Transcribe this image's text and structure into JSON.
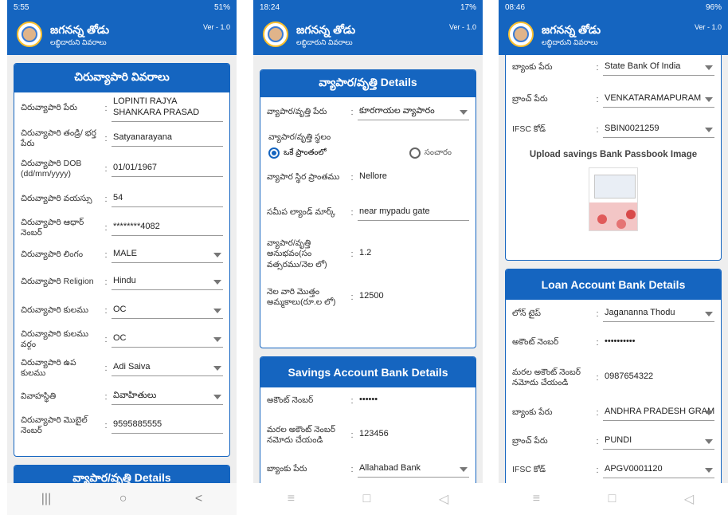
{
  "app": {
    "title": "జగనన్న తోడు",
    "subtitle": "లబ్ధిదారుని వివరాలు",
    "version": "Ver - 1.0"
  },
  "nav_icons": {
    "recents": "|||",
    "home": "○",
    "back": "<"
  },
  "screen1": {
    "status_time": "5:55",
    "status_right": "51%",
    "section_title": "చిరువ్యాపారి వివరాలు",
    "rows": [
      {
        "label": "చిరువ్యాపారి పేరు",
        "value": "LOPINTI RAJYA SHANKARA PRASAD"
      },
      {
        "label": "చిరువ్యాపారి తండ్రి/ భర్త పేరు",
        "value": "Satyanarayana"
      },
      {
        "label": "చిరువ్యాపారి DOB (dd/mm/yyyy)",
        "value": "01/01/1967"
      },
      {
        "label": "చిరువ్యాపారి వయస్సు",
        "value": "54"
      },
      {
        "label": "చిరువ్యాపారి ఆధార్ నెంబర్",
        "value": "********4082"
      },
      {
        "label": "చిరువ్యాపారి లింగం",
        "value": "MALE"
      },
      {
        "label": "చిరువ్యాపారి Religion",
        "value": "Hindu"
      },
      {
        "label": "చిరువ్యాపారి కులము",
        "value": "OC"
      },
      {
        "label": "చిరువ్యాపారి కులము వర్గం",
        "value": "OC"
      },
      {
        "label": "చిరువ్యాపారి ఉప కులము",
        "value": "Adi Saiva"
      },
      {
        "label": "వివాహస్థితి",
        "value": "వివాహితులు"
      },
      {
        "label": "చిరువ్యాపారి మొబైల్ నెంబర్",
        "value": "9595885555"
      }
    ],
    "next_section_title": "వ్యాపార/వృత్తి Details"
  },
  "screen2": {
    "status_time": "18:24",
    "status_right": "17%",
    "section_title": "వ్యాపార/వృత్తి Details",
    "business_type": {
      "label": "వ్యాపార/వృత్తి పేరు",
      "value": "కూరగాయల వ్యాపారం"
    },
    "location_label": "వ్యాపార/వృత్తి స్థలం",
    "radio_fixed": "ఒకే ప్రాంతంలో",
    "radio_mobile": "సంచారం",
    "rows": [
      {
        "label": "వ్యాపార స్థిర ప్రాంతము",
        "value": "Nellore"
      },
      {
        "label": "సమీప ల్యాండ్ మార్క్",
        "value": "near mypadu gate"
      },
      {
        "label": "వ్యాపార/వృత్తి అనుభవం(సం వత్సరము/నెల లో)",
        "value": "1.2"
      },
      {
        "label": "నెల వారి మొత్తం అమ్మకాలు(రూ.ల లో)",
        "value": "12500"
      }
    ],
    "savings_title": "Savings Account Bank Details",
    "savings_rows": [
      {
        "label": "అకౌంట్ నెంబర్",
        "value": "••••••"
      },
      {
        "label": "మరల అకౌంట్ నెంబర్ నమోదు చేయండి",
        "value": "123456"
      },
      {
        "label": "బ్యాంకు పేరు",
        "value": "Allahabad Bank"
      }
    ]
  },
  "screen3": {
    "status_time": "08:46",
    "status_right": "96%",
    "top_rows": [
      {
        "label": "బ్యాంకు పేరు",
        "value": "State Bank Of India"
      },
      {
        "label": "బ్రాంచ్ పేరు",
        "value": "VENKATARAMAPURAM"
      },
      {
        "label": "IFSC కోడ్",
        "value": "SBIN0021259"
      }
    ],
    "upload_label": "Upload savings Bank Passbook Image",
    "loan_title": "Loan Account Bank Details",
    "loan_rows": [
      {
        "label": "లోన్ టైప్",
        "value": "Jagananna Thodu"
      },
      {
        "label": "అకౌంట్ నెంబర్",
        "value": "••••••••••"
      },
      {
        "label": "మరల అకౌంట్ నెంబర్ నమోదు చేయండి",
        "value": "0987654322"
      },
      {
        "label": "బ్యాంకు పేరు",
        "value": "ANDHRA PRADESH GRAMEENA"
      },
      {
        "label": "బ్రాంచ్ పేరు",
        "value": "PUNDI"
      },
      {
        "label": "IFSC కోడ్",
        "value": "APGV0001120"
      }
    ]
  }
}
